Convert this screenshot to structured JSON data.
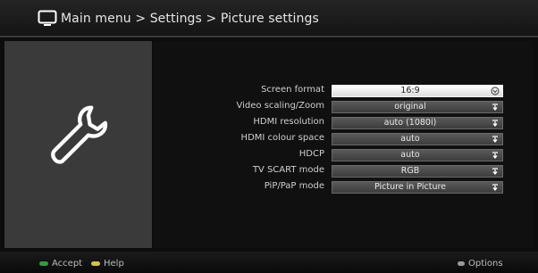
{
  "header": {
    "breadcrumb": "Main menu > Settings > Picture settings",
    "tv_icon": "tv-icon"
  },
  "left_panel": {
    "icon": "wrench-icon"
  },
  "settings": [
    {
      "label": "Screen format",
      "value": "16:9",
      "selected": true
    },
    {
      "label": "Video scaling/Zoom",
      "value": "original",
      "selected": false
    },
    {
      "label": "HDMI resolution",
      "value": "auto (1080i)",
      "selected": false
    },
    {
      "label": "HDMI colour space",
      "value": "auto",
      "selected": false
    },
    {
      "label": "HDCP",
      "value": "auto",
      "selected": false
    },
    {
      "label": "TV SCART mode",
      "value": "RGB",
      "selected": false
    },
    {
      "label": "PiP/PaP mode",
      "value": "Picture in Picture",
      "selected": false
    }
  ],
  "footer": {
    "accept_label": "Accept",
    "help_label": "Help",
    "options_label": "Options",
    "accept_color": "#2e9e3b",
    "help_color": "#d6c23a",
    "options_color": "#9a9a9a"
  }
}
